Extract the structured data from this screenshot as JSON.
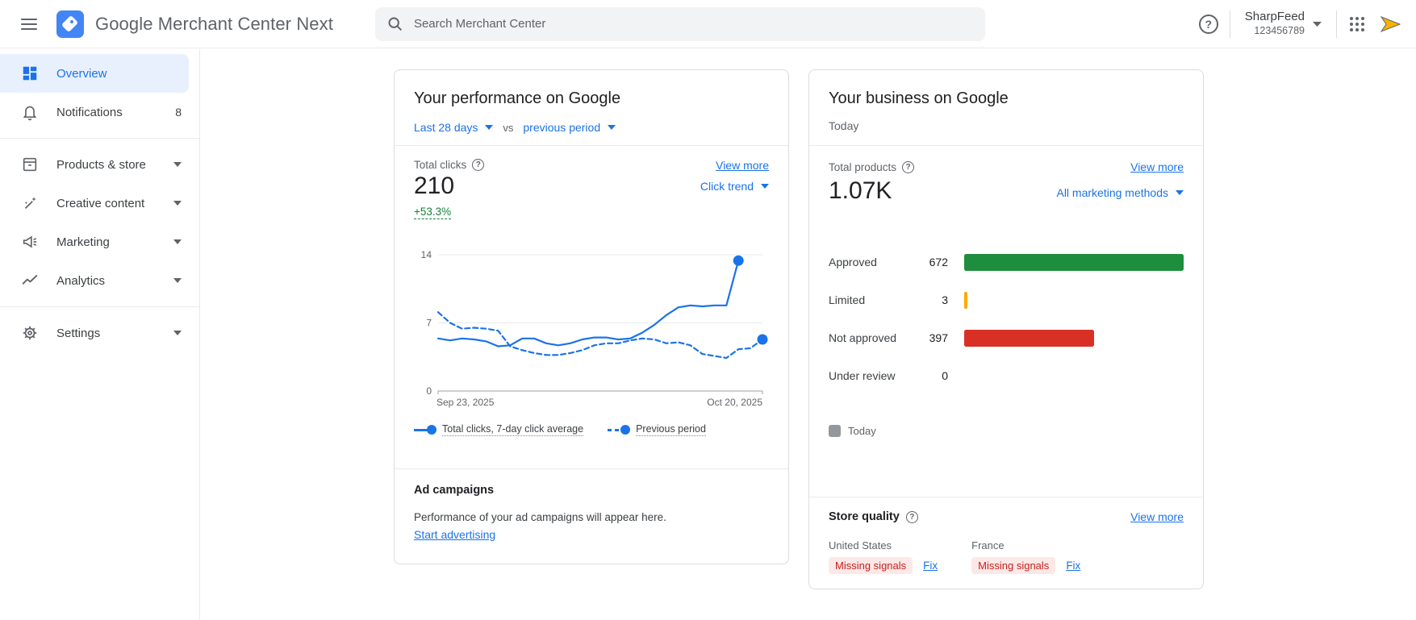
{
  "accent_color": "#1a73e8",
  "header": {
    "menu_icon": "hamburger-menu",
    "logo_icon": "merchant-center-tag",
    "product_title": "Google Merchant Center Next",
    "search": {
      "icon": "search-icon",
      "placeholder": "Search Merchant Center",
      "value": ""
    },
    "help_icon": "help-question-circle",
    "account": {
      "name": "SharpFeed",
      "id": "123456789",
      "caret_icon": "chevron-down"
    },
    "apps_icon": "apps-grid",
    "avatar_icon": "gold-arrow-avatar"
  },
  "sidebar": {
    "items": [
      {
        "label": "Overview",
        "icon": "dashboard",
        "selected": true
      },
      {
        "label": "Notifications",
        "icon": "bell",
        "badge": "8"
      },
      {
        "label": "Products & store",
        "icon": "inventory-box",
        "expandable": true
      },
      {
        "label": "Creative content",
        "icon": "magic-wand",
        "expandable": true
      },
      {
        "label": "Marketing",
        "icon": "megaphone",
        "expandable": true
      },
      {
        "label": "Analytics",
        "icon": "trend-line",
        "expandable": true
      },
      {
        "label": "Settings",
        "icon": "gear",
        "expandable": true
      }
    ]
  },
  "performance_card": {
    "title": "Your performance on Google",
    "period_selector": "Last 28 days",
    "vs_label": "vs",
    "compare_selector": "previous period",
    "metric_label": "Total clicks",
    "metric_value": "210",
    "metric_delta": "+53.3%",
    "delta_color": "#188038",
    "view_more": "View more",
    "trend_selector": "Click trend",
    "ad_campaigns": {
      "title": "Ad campaigns",
      "description": "Performance of your ad campaigns will appear here.",
      "cta": "Start advertising"
    }
  },
  "business_card": {
    "title": "Your business on Google",
    "subtitle": "Today",
    "metric_label": "Total products",
    "metric_value": "1.07K",
    "view_more": "View more",
    "filter_selector": "All marketing methods",
    "today_legend": "Today",
    "legend_swatch_color": "#80868b",
    "store_quality": {
      "title": "Store quality",
      "view_more": "View more",
      "regions": [
        {
          "name": "United States",
          "badge": "Missing signals",
          "action": "Fix"
        },
        {
          "name": "France",
          "badge": "Missing signals",
          "action": "Fix"
        }
      ],
      "badge_bg": "#fce8e6",
      "badge_text_color": "#c5221f"
    }
  },
  "chart_data": [
    {
      "id": "clicks_trend",
      "type": "line",
      "title": "Click trend — Total clicks, last 28 days vs previous period",
      "x_start_label": "Sep 23, 2025",
      "x_end_label": "Oct 20, 2025",
      "ylim": [
        0,
        14
      ],
      "y_ticks": [
        0,
        7,
        14
      ],
      "n_points": 28,
      "grid": "horizontal",
      "legend_position": "bottom",
      "line_color": "#1a73e8",
      "series": [
        {
          "name": "Total clicks, 7-day click average",
          "style": "solid",
          "color": "#1a73e8",
          "values": [
            5.4,
            5.2,
            5.4,
            5.3,
            5.1,
            4.6,
            4.7,
            5.4,
            5.4,
            4.9,
            4.7,
            4.9,
            5.3,
            5.5,
            5.5,
            5.3,
            5.4,
            6.0,
            6.8,
            7.8,
            8.6,
            8.8,
            8.7,
            8.8,
            8.8,
            13.4
          ]
        },
        {
          "name": "Previous period",
          "style": "dashed",
          "color": "#1a73e8",
          "values": [
            8.1,
            7.0,
            6.4,
            6.5,
            6.4,
            6.2,
            4.6,
            4.2,
            3.9,
            3.7,
            3.7,
            3.9,
            4.2,
            4.7,
            4.9,
            4.9,
            5.2,
            5.4,
            5.3,
            4.9,
            5.0,
            4.7,
            3.8,
            3.6,
            3.4,
            4.3,
            4.4,
            5.3
          ]
        }
      ]
    },
    {
      "id": "product_status",
      "type": "bar",
      "title": "Total products by status",
      "categories": [
        "Approved",
        "Limited",
        "Not approved",
        "Under review"
      ],
      "values": [
        672,
        3,
        397,
        0
      ],
      "colors": [
        "#1e8e3e",
        "#f9ab00",
        "#d93025",
        "#dadce0"
      ],
      "xlim": [
        0,
        672
      ],
      "legend": "Today"
    }
  ]
}
